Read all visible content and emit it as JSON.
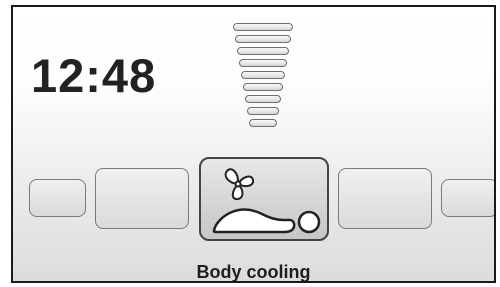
{
  "clock": {
    "time": "12:48"
  },
  "intensity_indicator": {
    "segments_total": 9,
    "segments_active": 9
  },
  "mode_carousel": {
    "items": [
      {
        "name": "far-left"
      },
      {
        "name": "left"
      },
      {
        "name": "body-cooling",
        "selected": true,
        "icons": [
          "fan-icon",
          "reclining-body-icon"
        ]
      },
      {
        "name": "right"
      },
      {
        "name": "far-right"
      }
    ],
    "selected_label": "Body cooling"
  }
}
